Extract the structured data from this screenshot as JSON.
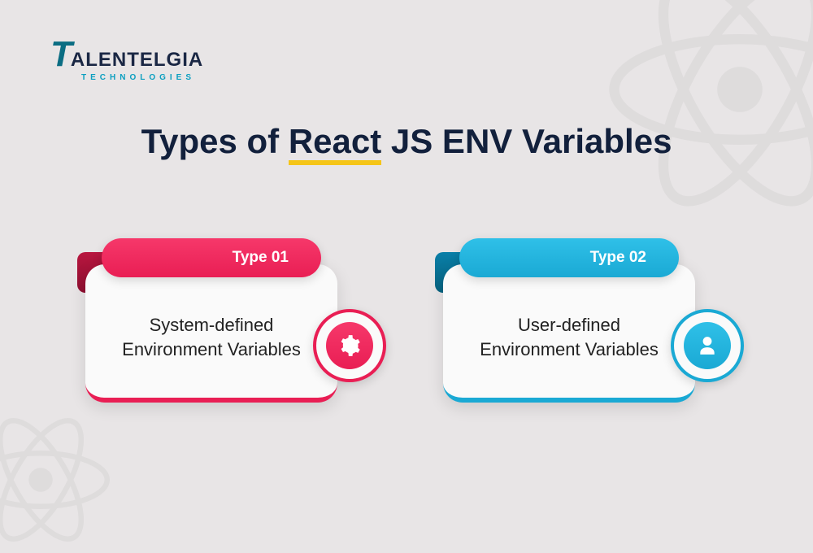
{
  "logo": {
    "brand_t": "T",
    "brand_rest": "ALENTELGIA",
    "sub": "TECHNOLOGIES"
  },
  "title": {
    "pre": "Types of ",
    "underlined": "React",
    "post": " JS ENV Variables"
  },
  "cards": [
    {
      "label": "Type 01",
      "text": "System-defined Environment Variables",
      "icon": "gear-icon",
      "color": "pink"
    },
    {
      "label": "Type 02",
      "text": "User-defined Environment Variables",
      "icon": "user-icon",
      "color": "blue"
    }
  ]
}
